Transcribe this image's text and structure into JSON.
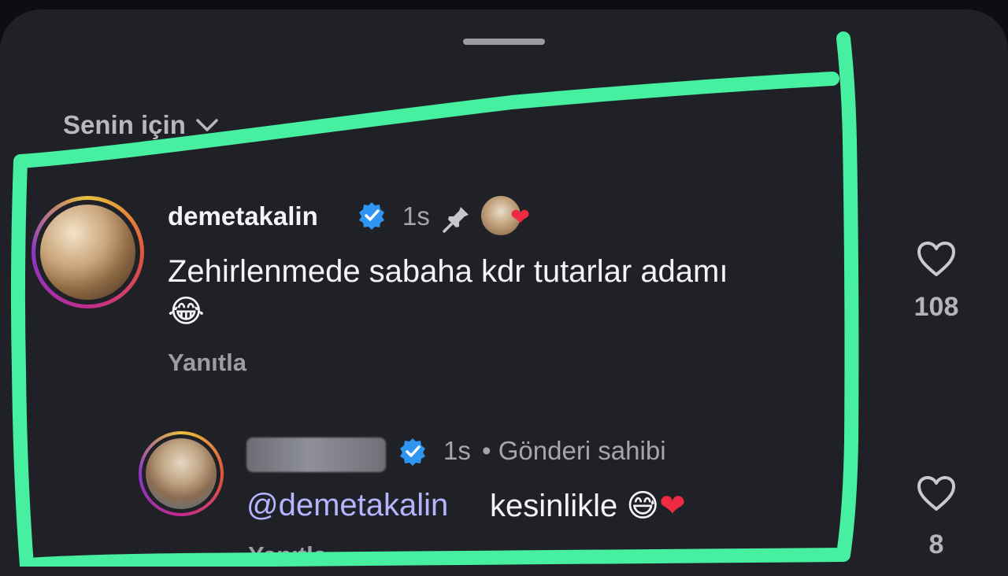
{
  "header": {
    "sort_label": "Senin için"
  },
  "comments": [
    {
      "username": "demetakalin",
      "time": "1s",
      "text": "Zehirlenmede sabaha kdr tutarlar adamı",
      "emoji": "😂",
      "reply_label": "Yanıtla",
      "like_count": "108"
    },
    {
      "time": "1s",
      "badge_separator": "•",
      "badge": "Gönderi sahibi",
      "mention": "@demetakalin",
      "text": "kesinlikle",
      "emoji": "😅",
      "heart": "❤",
      "reply_label": "Yanıtla",
      "like_count": "8"
    }
  ],
  "colors": {
    "background": "#202127",
    "verified": "#2f95f3",
    "highlight": "#46f0a0",
    "mention": "#b8b2ff",
    "liked_heart": "#ee2b42"
  },
  "icons": [
    "chevron-down-icon",
    "verified-icon",
    "pin-icon",
    "heart-outline-icon"
  ]
}
